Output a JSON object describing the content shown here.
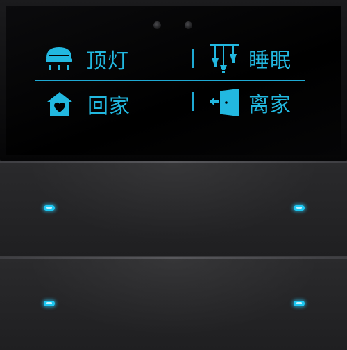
{
  "scenes": [
    {
      "id": "ceiling",
      "label": "顶灯",
      "icon": "ceiling-lamp-icon"
    },
    {
      "id": "sleep",
      "label": "睡眠",
      "icon": "pendant-lights-icon"
    },
    {
      "id": "home",
      "label": "回家",
      "icon": "house-heart-icon"
    },
    {
      "id": "away",
      "label": "离家",
      "icon": "door-exit-icon"
    }
  ],
  "colors": {
    "accent": "#22b8e0",
    "indicator": "#1ec8f2",
    "panel": "#000000",
    "rocker": "#232325"
  }
}
